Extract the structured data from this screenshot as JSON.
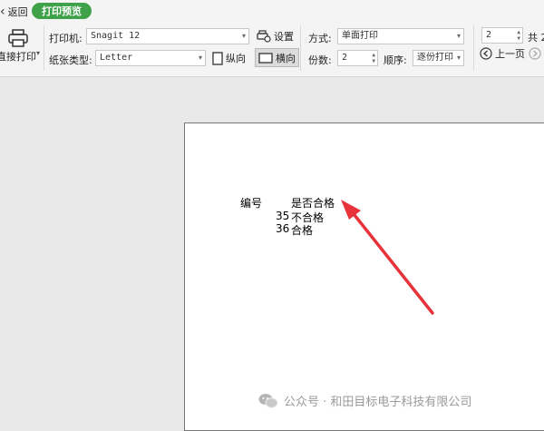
{
  "header": {
    "back_label": "返回",
    "mode_label": "打印预览"
  },
  "toolbar": {
    "print_button_label": "直接打印",
    "printer_label": "打印机:",
    "printer_value": "Snagit 12",
    "settings_label": "设置",
    "paper_type_label": "纸张类型:",
    "paper_value": "Letter",
    "portrait_label": "纵向",
    "landscape_label": "横向",
    "mode_label": "方式:",
    "mode_value": "单面打印",
    "copies_label": "份数:",
    "copies_value": "2",
    "order_label": "顺序:",
    "order_value": "逐份打印",
    "page_value": "2",
    "total_prefix": "共 2",
    "prev_page_label": "上一页"
  },
  "preview": {
    "header_col1": "编号",
    "header_col2": "是否合格",
    "rows": [
      {
        "id": "35",
        "status": "不合格"
      },
      {
        "id": "36",
        "status": "合格"
      }
    ]
  },
  "watermark": {
    "text": "公众号 · 和田目标电子科技有限公司"
  },
  "colors": {
    "accent_green": "#3fa24a",
    "arrow_red": "#e8333a"
  },
  "icons": {
    "back": "chevron-left-icon",
    "print": "printer-icon",
    "settings": "printer-settings-icon",
    "portrait": "portrait-page-icon",
    "landscape": "landscape-page-icon",
    "prev": "circle-arrow-left-icon",
    "next": "circle-arrow-right-icon",
    "watermark": "wechat-icon"
  }
}
